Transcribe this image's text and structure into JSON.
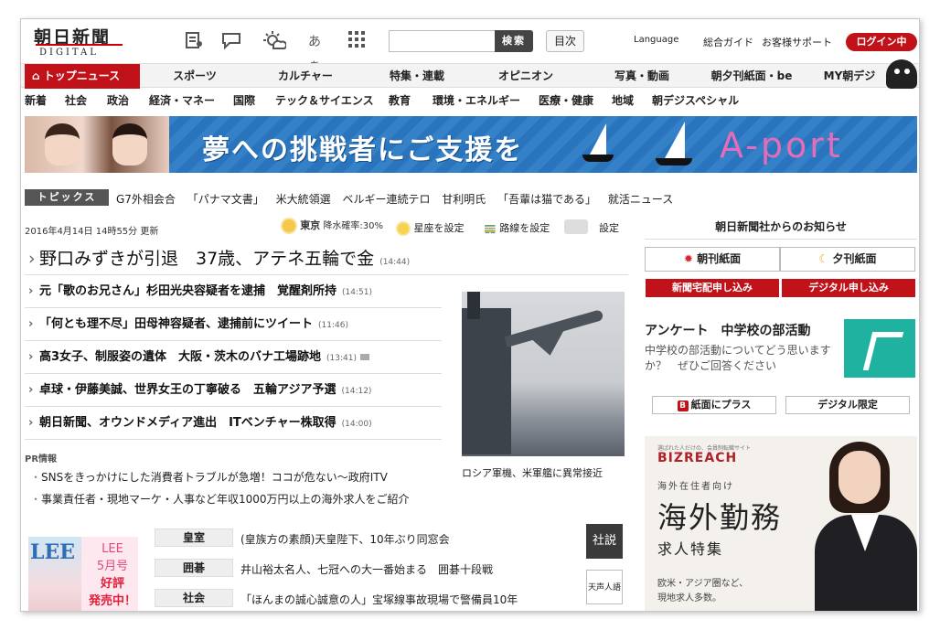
{
  "header": {
    "logo_main": "朝日新聞",
    "logo_sub": "DIGITAL",
    "search_placeholder": "",
    "search_button": "検索",
    "toc_button": "目次",
    "language": "Language",
    "guide": "総合ガイド",
    "support": "お客様サポート",
    "login": "ログイン中",
    "font_size_icon_label": "あぁ"
  },
  "mainnav": {
    "top": "トップニュース",
    "items": [
      "スポーツ",
      "カルチャー",
      "特集・連載",
      "オピニオン",
      "写真・動画",
      "朝夕刊紙面・be",
      "MY朝デジ"
    ]
  },
  "subnav": [
    "新着",
    "社会",
    "政治",
    "経済・マネー",
    "国際",
    "テック＆サイエンス",
    "教育",
    "環境・エネルギー",
    "医療・健康",
    "地域",
    "朝デジスペシャル"
  ],
  "banner": {
    "text": "夢への挑戦者にご支援を",
    "brand": "A-port"
  },
  "topics": {
    "label": "トピックス",
    "items": [
      "G7外相会合",
      "「パナマ文書」",
      "米大統領選",
      "ベルギー連続テロ",
      "甘利明氏",
      "「吾輩は猫である」",
      "就活ニュース"
    ]
  },
  "infobar": {
    "updated": "2016年4月14日 14時55分 更新",
    "city": "東京",
    "rain": "降水確率:30%",
    "horoscope": "星座を設定",
    "route": "路線を設定",
    "settings": "設定"
  },
  "headlines": {
    "lead": {
      "title": "野口みずきが引退　37歳、アテネ五輪で金",
      "time": "(14:44)"
    },
    "items": [
      {
        "title": "元「歌のお兄さん」杉田光央容疑者を逮捕　覚醒剤所持",
        "time": "(14:51)"
      },
      {
        "title": "「何とも理不尽」田母神容疑者、逮捕前にツイート",
        "time": "(11:46)"
      },
      {
        "title": "高3女子、制服姿の遺体　大阪・茨木のバナ工場跡地",
        "time": "(13:41)"
      },
      {
        "title": "卓球・伊藤美誠、世界女王の丁寧破る　五輪アジア予選",
        "time": "(14:12)"
      },
      {
        "title": "朝日新聞、オウンドメディア進出　ITベンチャー株取得",
        "time": "(14:00)"
      }
    ]
  },
  "photo_caption": "ロシア軍機、米軍艦に異常接近",
  "pr": {
    "label": "PR情報",
    "items": [
      "SNSをきっかけにした消費者トラブルが急増！ココが危ない～政府ITV",
      "事業責任者・現地マーケ・人事など年収1000万円以上の海外求人をご紹介"
    ]
  },
  "lee": {
    "logo": "LEE",
    "lines": [
      "LEE",
      "5月号",
      "好評",
      "発売中！"
    ]
  },
  "categories": [
    {
      "label": "皇室",
      "text": "(皇族方の素顔)天皇陛下、10年ぶり同窓会"
    },
    {
      "label": "囲碁",
      "text": "井山裕太名人、七冠への大一番始まる　囲碁十段戦"
    },
    {
      "label": "社会",
      "text": "「ほんまの誠心誠意の人」宝塚線事故現場で警備員10年"
    }
  ],
  "side_badges": {
    "shasetsu": "社説",
    "tensei": "天声人語"
  },
  "right": {
    "notice_title": "朝日新聞社からのお知らせ",
    "morning": "朝刊紙面",
    "evening": "夕刊紙面",
    "delivery": "新聞宅配申し込み",
    "digital_apply": "デジタル申し込み",
    "survey_title": "アンケート　中学校の部活動",
    "survey_text": "中学校の部活動についてどう思いますか？　ぜひご回答ください",
    "plus_paper": "紙面にプラス",
    "digital_limited": "デジタル限定",
    "plus_badge": "B"
  },
  "ad": {
    "tagline": "選ばれた人だけの、会員制転職サイト",
    "logo": "BIZREACH",
    "line1": "海外在住者向け",
    "big": "海外勤務",
    "med": "求人特集",
    "small1": "欧米・アジア圏など、",
    "small2": "現地求人多数。"
  },
  "colors": {
    "brand_red": "#c1121a",
    "banner_blue": "#2a74bd",
    "aport_pink": "#e56cb8",
    "survey_teal": "#1fb2a0"
  }
}
